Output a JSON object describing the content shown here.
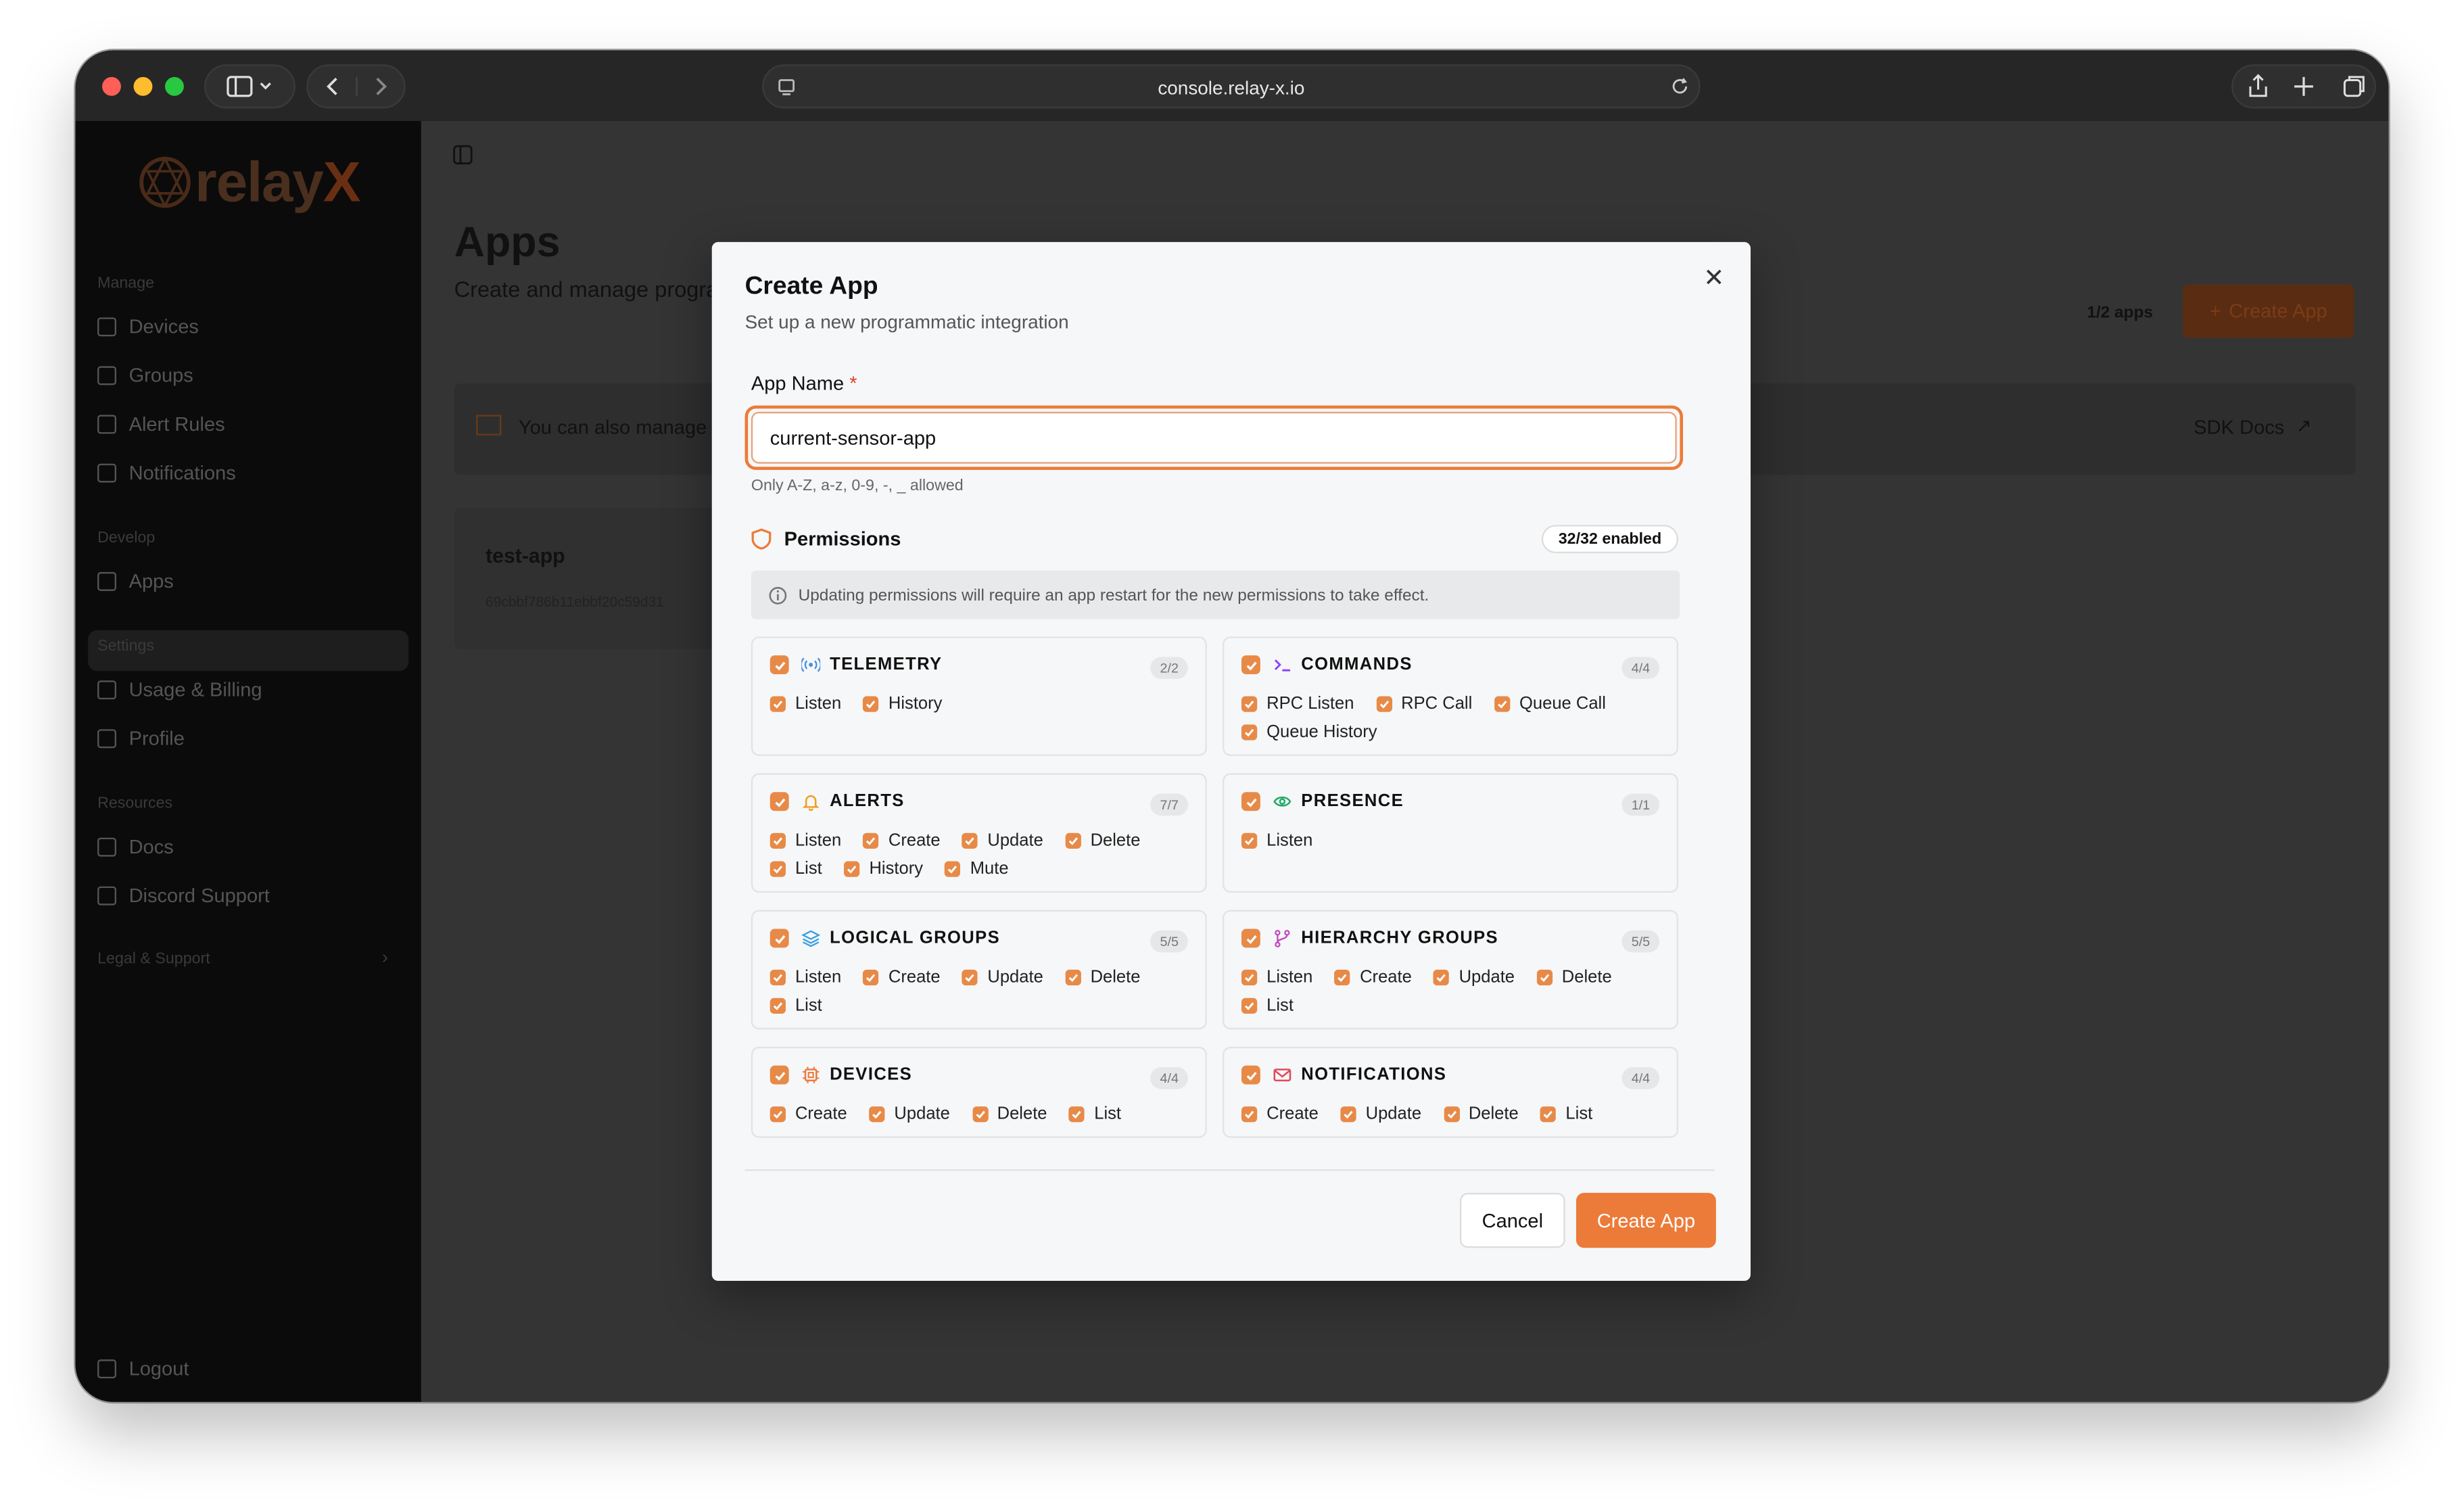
{
  "browser": {
    "url": "console.relay-x.io"
  },
  "sidebar": {
    "logo": "relay",
    "logo_accent": "X",
    "sections": [
      {
        "title": "Manage",
        "items": [
          "Devices",
          "Groups",
          "Alert Rules",
          "Notifications"
        ]
      },
      {
        "title": "Develop",
        "items": [
          "Apps"
        ]
      },
      {
        "title": "Settings",
        "items": [
          "Usage & Billing",
          "Profile"
        ]
      },
      {
        "title": "Resources",
        "items": [
          "Docs",
          "Discord Support"
        ]
      }
    ],
    "legal": "Legal & Support",
    "logout": "Logout",
    "active": "Apps"
  },
  "page": {
    "title": "Apps",
    "subtitle": "Create and manage progra",
    "app_count": "1/2 apps",
    "create_button": "Create App",
    "banner": "You can also manage a",
    "sdk_docs": "SDK Docs",
    "app_card": {
      "name": "test-app",
      "id": "69cbbf786b11ebbf20c59d31"
    }
  },
  "modal": {
    "title": "Create App",
    "subtitle": "Set up a new programmatic integration",
    "name_label": "App Name",
    "required_mark": "*",
    "name_value": "current-sensor-app",
    "hint": "Only A-Z, a-z, 0-9, -, _ allowed",
    "permissions_title": "Permissions",
    "permissions_badge": "32/32 enabled",
    "notice": "Updating permissions will require an app restart for the new permissions to take effect.",
    "cancel": "Cancel",
    "create": "Create App",
    "groups": [
      {
        "title": "TELEMETRY",
        "count": "2/2",
        "icon": "signal-icon",
        "color": "#4a90e2",
        "items": [
          "Listen",
          "History"
        ]
      },
      {
        "title": "COMMANDS",
        "count": "4/4",
        "icon": "terminal-icon",
        "color": "#8a3ffc",
        "items": [
          "RPC Listen",
          "RPC Call",
          "Queue Call",
          "Queue History"
        ]
      },
      {
        "title": "ALERTS",
        "count": "7/7",
        "icon": "bell-icon",
        "color": "#f0a020",
        "items": [
          "Listen",
          "Create",
          "Update",
          "Delete",
          "List",
          "History",
          "Mute"
        ]
      },
      {
        "title": "PRESENCE",
        "count": "1/1",
        "icon": "eye-icon",
        "color": "#22aa66",
        "items": [
          "Listen"
        ]
      },
      {
        "title": "LOGICAL GROUPS",
        "count": "5/5",
        "icon": "layers-icon",
        "color": "#3aa0e0",
        "items": [
          "Listen",
          "Create",
          "Update",
          "Delete",
          "List"
        ]
      },
      {
        "title": "HIERARCHY GROUPS",
        "count": "5/5",
        "icon": "branch-icon",
        "color": "#c04ac0",
        "items": [
          "Listen",
          "Create",
          "Update",
          "Delete",
          "List"
        ]
      },
      {
        "title": "DEVICES",
        "count": "4/4",
        "icon": "chip-icon",
        "color": "#ec7b3a",
        "items": [
          "Create",
          "Update",
          "Delete",
          "List"
        ]
      },
      {
        "title": "NOTIFICATIONS",
        "count": "4/4",
        "icon": "mail-icon",
        "color": "#e04a5a",
        "items": [
          "Create",
          "Update",
          "Delete",
          "List"
        ]
      }
    ]
  }
}
